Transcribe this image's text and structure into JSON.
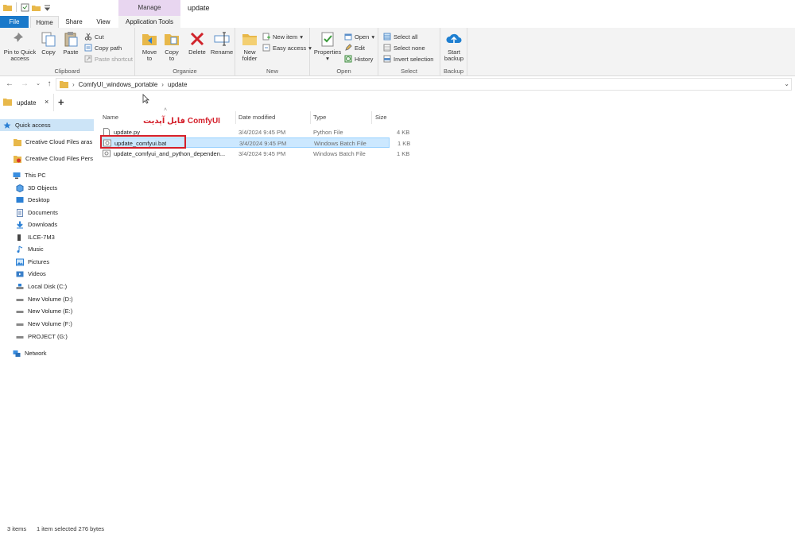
{
  "window": {
    "title": "update"
  },
  "ribbon_tabs": {
    "file": "File",
    "home": "Home",
    "share": "Share",
    "view": "View",
    "manage": "Manage",
    "app_tools": "Application Tools"
  },
  "clipboard": {
    "pin": "Pin to Quick\naccess",
    "copy": "Copy",
    "paste": "Paste",
    "cut": "Cut",
    "copy_path": "Copy path",
    "paste_shortcut": "Paste shortcut",
    "label": "Clipboard"
  },
  "organize": {
    "move_to": "Move\nto",
    "copy_to": "Copy\nto",
    "delete": "Delete",
    "rename": "Rename",
    "label": "Organize"
  },
  "new_group": {
    "new_folder": "New\nfolder",
    "new_item": "New item",
    "easy_access": "Easy access",
    "label": "New"
  },
  "open_group": {
    "properties": "Properties",
    "open": "Open",
    "edit": "Edit",
    "history": "History",
    "label": "Open"
  },
  "select_group": {
    "select_all": "Select all",
    "select_none": "Select none",
    "invert": "Invert selection",
    "label": "Select"
  },
  "backup_group": {
    "start_backup": "Start\nbackup",
    "label": "Backup"
  },
  "address": {
    "crumbs": [
      "ComfyUI_windows_portable",
      "update"
    ]
  },
  "folder_tab": {
    "name": "update",
    "close": "×",
    "add": "+"
  },
  "nav": {
    "quick_access": "Quick access",
    "cc1": "Creative Cloud Files  aras",
    "cc2": "Creative Cloud Files Pers",
    "this_pc": "This PC",
    "objects": "3D Objects",
    "desktop": "Desktop",
    "documents": "Documents",
    "downloads": "Downloads",
    "ilce": "ILCE-7M3",
    "music": "Music",
    "pictures": "Pictures",
    "videos": "Videos",
    "local_c": "Local Disk (C:)",
    "vol_d": "New Volume (D:)",
    "vol_e": "New Volume (E:)",
    "vol_f": "New Volume (F:)",
    "project_g": "PROJECT (G:)",
    "network": "Network"
  },
  "columns": {
    "name": "Name",
    "date": "Date modified",
    "type": "Type",
    "size": "Size"
  },
  "files": [
    {
      "name": "update.py",
      "date": "3/4/2024 9:45 PM",
      "type": "Python File",
      "size": "4 KB"
    },
    {
      "name": "update_comfyui.bat",
      "date": "3/4/2024 9:45 PM",
      "type": "Windows Batch File",
      "size": "1 KB"
    },
    {
      "name": "update_comfyui_and_python_dependen...",
      "date": "3/4/2024 9:45 PM",
      "type": "Windows Batch File",
      "size": "1 KB"
    }
  ],
  "annotation": "فایل آپدیت ComfyUI",
  "status": {
    "items": "3 items",
    "selected": "1 item selected  276 bytes"
  },
  "colors": {
    "accent": "#1979ca",
    "manage": "#e8d6f0",
    "selection": "#cce8ff",
    "highlight": "#d41f2a"
  }
}
